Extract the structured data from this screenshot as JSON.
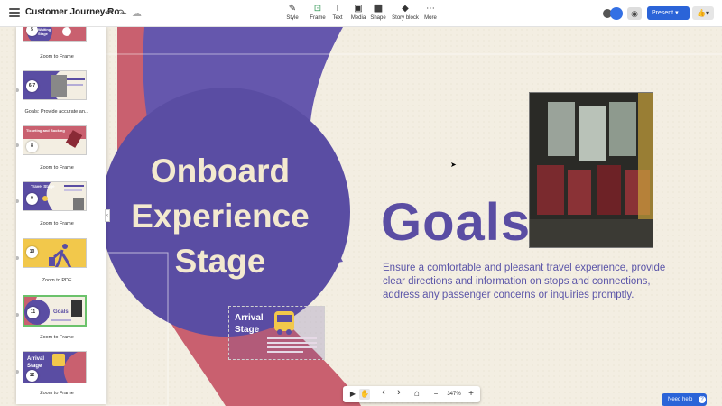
{
  "header": {
    "title": "Customer Journey Ro...",
    "undo_icon": "↶",
    "redo_icon": "↷",
    "cloud_icon": "☁",
    "tools": [
      {
        "label": "Style",
        "icon": "✎"
      },
      {
        "label": "Frame",
        "icon": "⊡"
      },
      {
        "label": "Text",
        "icon": "T"
      },
      {
        "label": "Media",
        "icon": "▣"
      },
      {
        "label": "Shape",
        "icon": "⬛"
      },
      {
        "label": "Story block",
        "icon": "◆"
      },
      {
        "label": "More",
        "icon": "⋯"
      }
    ],
    "eye_icon": "◉",
    "present_label": "Present ▾",
    "share_icon": "👍▾"
  },
  "sidebar": {
    "toggle_icon": "‹",
    "slides": [
      {
        "num": "5",
        "title": "Waiting Stage",
        "caption": "Zoom to Frame"
      },
      {
        "num": "6-7",
        "title": "",
        "caption": "Goals: Provide accurate an..."
      },
      {
        "num": "8",
        "title": "Ticketing and Booking",
        "caption": "Zoom to Frame"
      },
      {
        "num": "9",
        "title": "Travel Stage",
        "caption": "Zoom to Frame"
      },
      {
        "num": "10",
        "title": "",
        "caption": "Zoom to PDF"
      },
      {
        "num": "11",
        "title": "Goals",
        "caption": "Zoom to Frame"
      },
      {
        "num": "12",
        "title": "Arrival Stage",
        "caption": "Zoom to Frame"
      }
    ]
  },
  "slide": {
    "title": "Onboard Experience Stage",
    "goals_heading": "Goals",
    "goals_text": "Ensure a comfortable and pleasant travel experience, provide clear directions and information on stops and connections, address any passenger concerns or inquiries promptly.",
    "arrival_title": "Arrival Stage"
  },
  "bottom": {
    "zoom": "347%",
    "pointer_icon": "▶",
    "hand_icon": "✋",
    "prev_icon": "‹",
    "next_icon": "›",
    "home_icon": "⌂",
    "zoom_out_icon": "−",
    "zoom_in_icon": "+"
  },
  "help": {
    "label": "Need help",
    "icon": "?"
  },
  "colors": {
    "purple": "#5a4da3",
    "pink": "#c9606f",
    "cream": "#f3eee2",
    "yellow": "#f2c84b",
    "blue": "#2b64d8"
  }
}
